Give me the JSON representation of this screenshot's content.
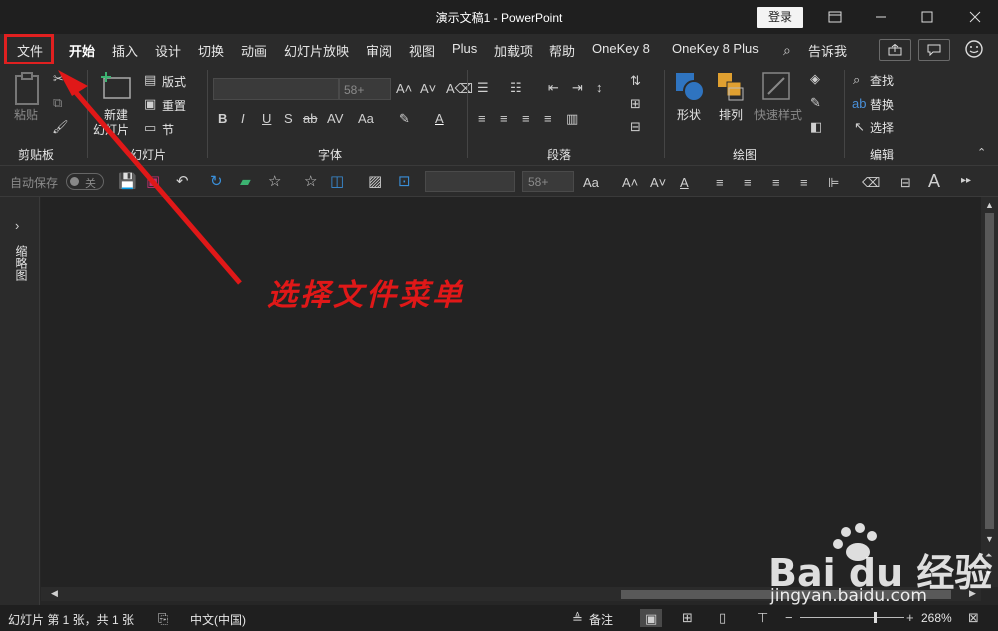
{
  "window": {
    "title": "演示文稿1  -  PowerPoint",
    "login_label": "登录"
  },
  "tabs": [
    "文件",
    "开始",
    "插入",
    "设计",
    "切换",
    "动画",
    "幻灯片放映",
    "审阅",
    "视图",
    "Plus",
    "加载项",
    "帮助",
    "OneKey 8",
    "OneKey 8 Plus"
  ],
  "tell_me": "告诉我",
  "ribbon": {
    "clipboard": {
      "paste": "粘贴",
      "label": "剪贴板"
    },
    "slides": {
      "new_slide": "新建",
      "new_slide2": "幻灯片",
      "layout": "版式",
      "reset": "重置",
      "section": "节",
      "label": "幻灯片"
    },
    "font": {
      "size": "58+",
      "label": "字体"
    },
    "paragraph": {
      "label": "段落"
    },
    "drawing": {
      "shapes": "形状",
      "arrange": "排列",
      "quick_styles": "快速样式",
      "label": "绘图"
    },
    "editing": {
      "find": "查找",
      "replace": "替换",
      "select": "选择",
      "label": "编辑"
    }
  },
  "qat": {
    "autosave": "自动保存",
    "autosave_state": "关",
    "font_size": "58+"
  },
  "left_pane": {
    "label": "缩略图"
  },
  "status": {
    "slide_info": "幻灯片 第 1 张，共 1 张",
    "language": "中文(中国)",
    "notes": "备注",
    "zoom": "268%"
  },
  "annotation": "选择文件菜单",
  "watermark": {
    "brand": "Bai du 经验",
    "url": "jingyan.baidu.com"
  },
  "colors": {
    "highlight": "#e02020",
    "background": "#2b2b2b"
  }
}
